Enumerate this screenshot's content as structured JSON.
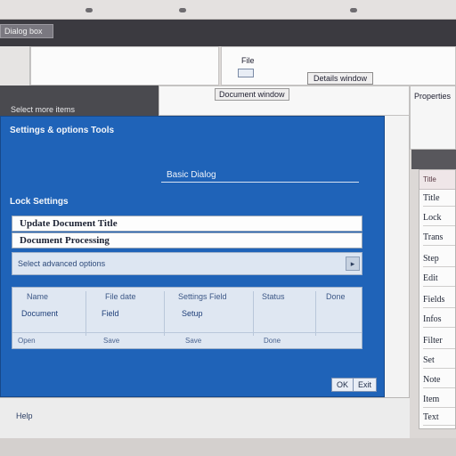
{
  "top_bar": {
    "dots": [
      "",
      "",
      ""
    ]
  },
  "app": {
    "title_button": "Dialog box",
    "title_text": ""
  },
  "background_windows": {
    "panel_b_label": "File",
    "panel_b_chip": "Details window",
    "row2_chip": "Document window",
    "row2_right_text": "Properties",
    "row2_dark_text": "Select more items"
  },
  "dialog": {
    "title": "Settings & options Tools",
    "heading": "Basic Dialog",
    "section_label": "Lock Settings",
    "field_1": "Update Document Title",
    "field_2": "Document Processing",
    "select_text": "Select advanced options",
    "select_button": "▸",
    "table": {
      "headers": [
        "Name",
        "File date",
        "Settings Field",
        "Status",
        "Done"
      ],
      "values": [
        "Document",
        "Field",
        "Setup"
      ],
      "footer": [
        "Open",
        "Save",
        "Save",
        "Done"
      ]
    },
    "buttons": [
      "OK",
      "Exit"
    ]
  },
  "status_text": "Help",
  "right_panel": {
    "header": "Title",
    "items": [
      "Title",
      "Lock",
      "Trans",
      "Step",
      "Edit",
      "Fields",
      "Infos",
      "Filter",
      "Set",
      "Note",
      "Item",
      "Text"
    ]
  },
  "colors": {
    "dialog_blue": "#1f63b8",
    "title_dark": "#3b3a40"
  }
}
